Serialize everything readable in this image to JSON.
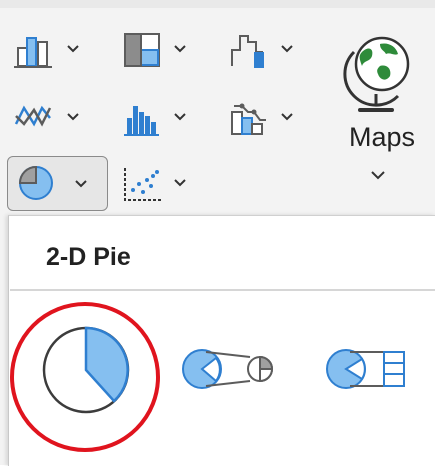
{
  "ribbon": {
    "buttons": [
      {
        "name": "column-chart",
        "icon": "column-chart-icon"
      },
      {
        "name": "hierarchy-chart",
        "icon": "hierarchy-chart-icon"
      },
      {
        "name": "waterfall-chart",
        "icon": "waterfall-chart-icon"
      },
      {
        "name": "line-chart",
        "icon": "line-chart-icon"
      },
      {
        "name": "statistic-chart",
        "icon": "histogram-chart-icon"
      },
      {
        "name": "combo-chart",
        "icon": "combo-chart-icon"
      },
      {
        "name": "pie-chart",
        "icon": "pie-chart-icon",
        "selected": true
      },
      {
        "name": "scatter-chart",
        "icon": "scatter-chart-icon"
      }
    ],
    "maps": {
      "label": "Maps",
      "icon": "globe-icon"
    }
  },
  "dropdown": {
    "section_title": "2-D Pie",
    "options": [
      {
        "name": "pie",
        "icon": "pie-icon",
        "highlighted": true
      },
      {
        "name": "pie-of-pie",
        "icon": "pie-of-pie-icon"
      },
      {
        "name": "bar-of-pie",
        "icon": "bar-of-pie-icon"
      }
    ]
  },
  "colors": {
    "accent_blue": "#2f7fd0",
    "fill_blue": "#85bff0",
    "highlight_red": "#e0141e",
    "icon_gray": "#5c5c5c"
  }
}
